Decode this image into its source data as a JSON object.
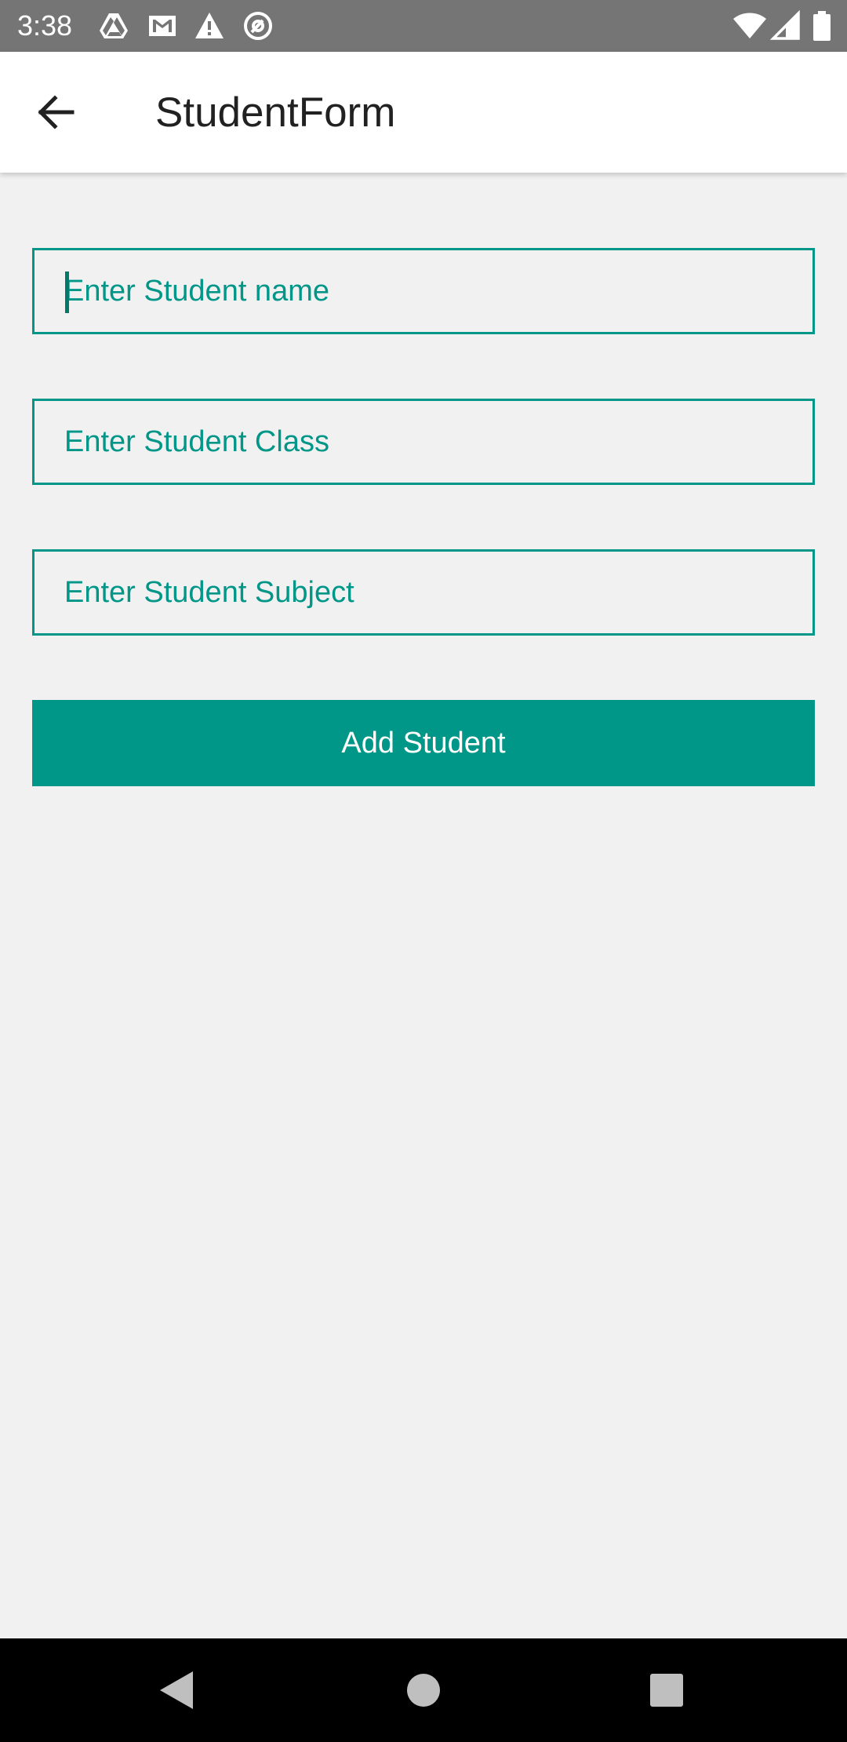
{
  "status_bar": {
    "time": "3:38",
    "left_icons": [
      "drive-icon",
      "gmail-icon",
      "warning-icon",
      "sync-icon"
    ],
    "right_icons": [
      "wifi-icon",
      "signal-icon",
      "battery-icon"
    ]
  },
  "app_bar": {
    "title": "StudentForm",
    "back_icon": "arrow-back-icon"
  },
  "form": {
    "name_field": {
      "placeholder": "Enter Student name",
      "value": ""
    },
    "class_field": {
      "placeholder": "Enter Student Class",
      "value": ""
    },
    "subject_field": {
      "placeholder": "Enter Student Subject",
      "value": ""
    },
    "submit_label": "Add Student"
  },
  "nav_bar": {
    "buttons": [
      "back-triangle-icon",
      "home-circle-icon",
      "recents-square-icon"
    ]
  },
  "colors": {
    "accent": "#009688",
    "status_bar": "#757575",
    "background": "#f1f1f1",
    "nav_bar": "#000000"
  }
}
